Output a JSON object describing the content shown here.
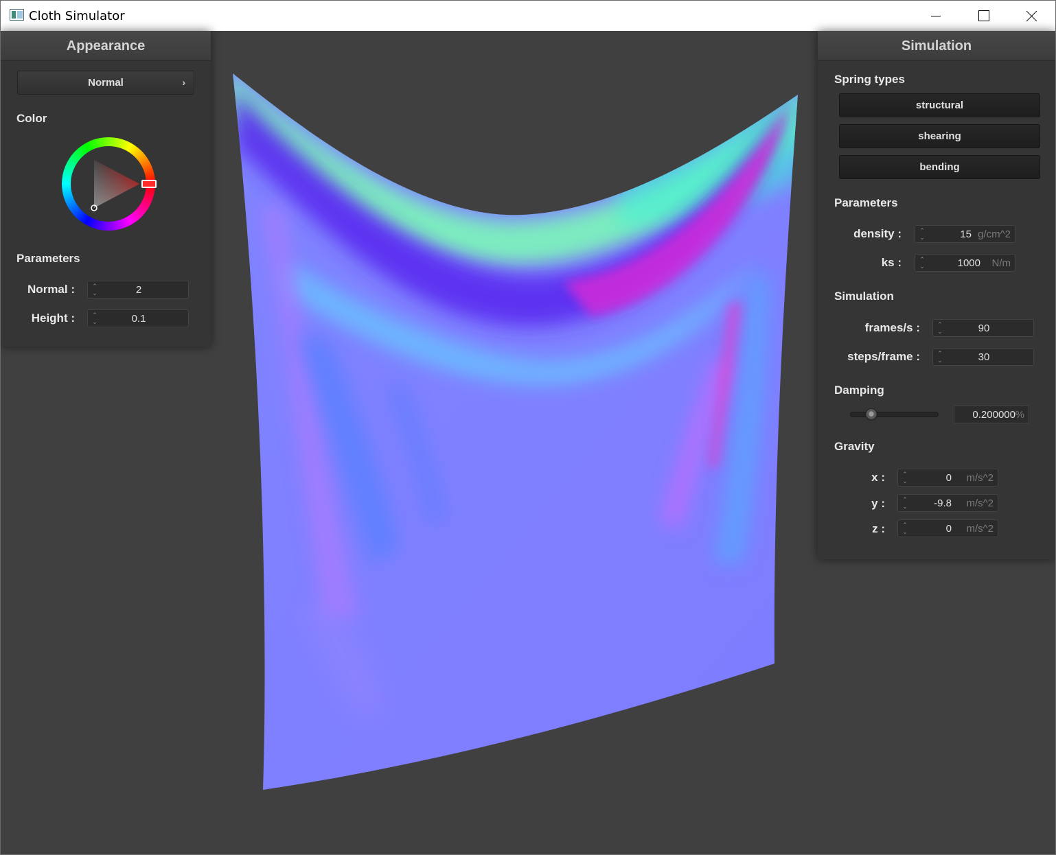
{
  "window": {
    "title": "Cloth Simulator"
  },
  "appearance": {
    "header": "Appearance",
    "shader_select": "Normal",
    "color_label": "Color",
    "color": "#ff2a2a",
    "params_label": "Parameters",
    "normal_label": "Normal :",
    "normal_value": "2",
    "height_label": "Height :",
    "height_value": "0.1"
  },
  "simulation": {
    "header": "Simulation",
    "spring_types_label": "Spring types",
    "spring_types": [
      "structural",
      "shearing",
      "bending"
    ],
    "params_label": "Parameters",
    "density_label": "density :",
    "density_value": "15",
    "density_unit": "g/cm^2",
    "ks_label": "ks :",
    "ks_value": "1000",
    "ks_unit": "N/m",
    "sim_label": "Simulation",
    "fps_label": "frames/s :",
    "fps_value": "90",
    "steps_label": "steps/frame :",
    "steps_value": "30",
    "damping_label": "Damping",
    "damping_value": "0.200000",
    "damping_unit": "%",
    "damping_fraction": 0.2,
    "gravity_label": "Gravity",
    "gx_label": "x :",
    "gx_value": "0",
    "gy_label": "y :",
    "gy_value": "-9.8",
    "gz_label": "z :",
    "gz_value": "0",
    "g_unit": "m/s^2"
  }
}
